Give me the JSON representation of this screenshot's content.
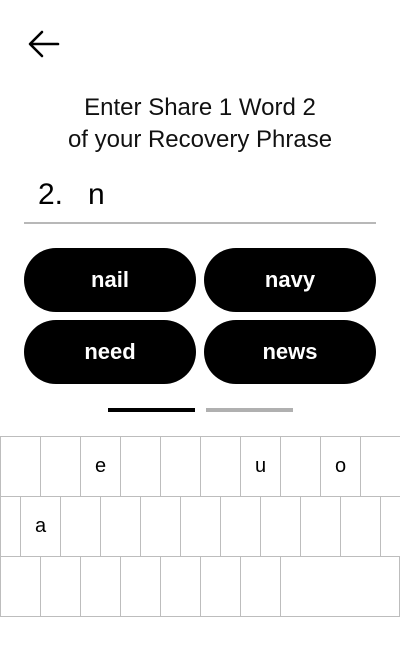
{
  "title": {
    "line1": "Enter Share 1 Word 2",
    "line2": "of your Recovery Phrase"
  },
  "entry": {
    "index": "2.",
    "value": "n"
  },
  "suggestions": [
    "nail",
    "navy",
    "need",
    "news"
  ],
  "pager": {
    "pages": 2,
    "current": 1
  },
  "keyboard": {
    "rows": [
      [
        "",
        "",
        "e",
        "",
        "",
        "",
        "u",
        "",
        "o",
        ""
      ],
      [
        "",
        "a",
        "",
        "",
        "",
        "",
        "",
        "",
        "",
        ""
      ],
      [
        "",
        "",
        "",
        "",
        "",
        "",
        "",
        ""
      ]
    ]
  },
  "icons": {
    "back": "arrow-left-icon"
  },
  "colors": {
    "accent": "#000000",
    "pager_active": "#000000",
    "pager_inactive": "#b0b0b0",
    "key_border": "#bdbdbd"
  }
}
